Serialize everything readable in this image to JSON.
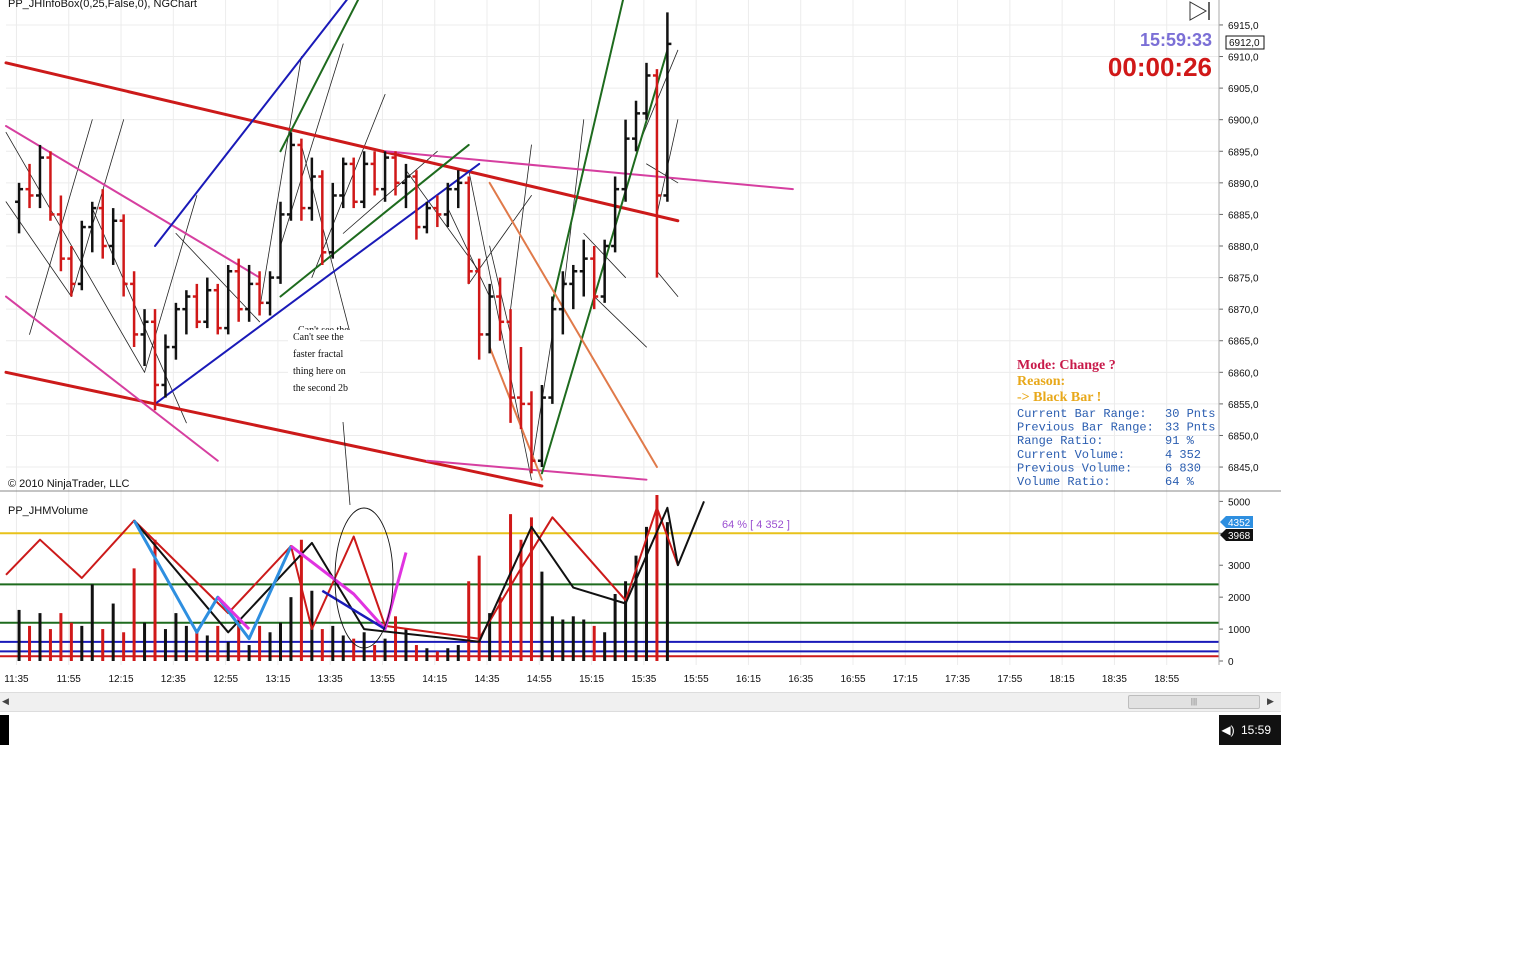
{
  "window": {
    "title": "PP_JHInfoBox(0,25,False,0), NGChart",
    "copyright": "© 2010 NinjaTrader, LLC",
    "volume_panel_title": "PP_JHMVolume"
  },
  "clock": {
    "time": "15:59:33",
    "countdown": "00:00:26"
  },
  "price_marker": "6912,0",
  "volume_markers": {
    "current": "4352",
    "threshold": "3968"
  },
  "volume_annotation": "64 % [ 4 352 ]",
  "note_text": [
    "Can't see the",
    "faster fractal",
    "thing here on",
    "the second 2b"
  ],
  "note_overlap_text": "Can't see the",
  "info_box": {
    "mode": "Mode: Change ?",
    "reason_label": "Reason:",
    "reason_value": "->  Black Bar !",
    "rows": [
      {
        "label": "Current Bar Range:",
        "value": "30 Pnts"
      },
      {
        "label": "Previous Bar Range:",
        "value": "33 Pnts"
      },
      {
        "label": "Range Ratio:",
        "value": "91 %"
      },
      {
        "label": "Current Volume:",
        "value": "4 352"
      },
      {
        "label": "Previous Volume:",
        "value": "6 830"
      },
      {
        "label": "Volume Ratio:",
        "value": "64 %"
      }
    ]
  },
  "taskbar_time": "15:59",
  "colors": {
    "bull": "#111111",
    "bear": "#d01818",
    "trend_red": "#cc1a1a",
    "pink": "#d63fa0",
    "blue": "#1a1ab8",
    "green": "#1e6b1e",
    "orange": "#e07a4a",
    "light_blue": "#2e8fe0",
    "magenta": "#e033e0",
    "yellow": "#e8c21a"
  },
  "chart_data": [
    {
      "type": "ohlc",
      "y_ticks": [
        "6915,0",
        "6910,0",
        "6905,0",
        "6900,0",
        "6895,0",
        "6890,0",
        "6885,0",
        "6880,0",
        "6875,0",
        "6870,0",
        "6865,0",
        "6860,0",
        "6855,0",
        "6850,0",
        "6845,0"
      ],
      "ylim": [
        6842,
        6918
      ],
      "time_range": [
        "11:31",
        "19:15"
      ],
      "bars": [
        {
          "t": "11:36",
          "o": 6887,
          "h": 6890,
          "l": 6882,
          "c": 6889
        },
        {
          "t": "11:40",
          "o": 6889,
          "h": 6893,
          "l": 6886,
          "c": 6888
        },
        {
          "t": "11:44",
          "o": 6888,
          "h": 6896,
          "l": 6886,
          "c": 6894
        },
        {
          "t": "11:48",
          "o": 6894,
          "h": 6895,
          "l": 6884,
          "c": 6885
        },
        {
          "t": "11:52",
          "o": 6885,
          "h": 6888,
          "l": 6876,
          "c": 6878
        },
        {
          "t": "11:56",
          "o": 6878,
          "h": 6880,
          "l": 6872,
          "c": 6874
        },
        {
          "t": "12:00",
          "o": 6874,
          "h": 6884,
          "l": 6873,
          "c": 6883
        },
        {
          "t": "12:04",
          "o": 6883,
          "h": 6887,
          "l": 6879,
          "c": 6886
        },
        {
          "t": "12:08",
          "o": 6886,
          "h": 6889,
          "l": 6878,
          "c": 6880
        },
        {
          "t": "12:12",
          "o": 6880,
          "h": 6886,
          "l": 6877,
          "c": 6884
        },
        {
          "t": "12:16",
          "o": 6884,
          "h": 6885,
          "l": 6872,
          "c": 6874
        },
        {
          "t": "12:20",
          "o": 6874,
          "h": 6876,
          "l": 6864,
          "c": 6866
        },
        {
          "t": "12:24",
          "o": 6866,
          "h": 6870,
          "l": 6861,
          "c": 6868
        },
        {
          "t": "12:28",
          "o": 6868,
          "h": 6870,
          "l": 6854,
          "c": 6858
        },
        {
          "t": "12:32",
          "o": 6858,
          "h": 6866,
          "l": 6856,
          "c": 6864
        },
        {
          "t": "12:36",
          "o": 6864,
          "h": 6871,
          "l": 6862,
          "c": 6870
        },
        {
          "t": "12:40",
          "o": 6870,
          "h": 6873,
          "l": 6866,
          "c": 6872
        },
        {
          "t": "12:44",
          "o": 6872,
          "h": 6874,
          "l": 6867,
          "c": 6868
        },
        {
          "t": "12:48",
          "o": 6868,
          "h": 6875,
          "l": 6867,
          "c": 6873
        },
        {
          "t": "12:52",
          "o": 6873,
          "h": 6874,
          "l": 6866,
          "c": 6867
        },
        {
          "t": "12:56",
          "o": 6867,
          "h": 6877,
          "l": 6866,
          "c": 6876
        },
        {
          "t": "13:00",
          "o": 6876,
          "h": 6878,
          "l": 6868,
          "c": 6870
        },
        {
          "t": "13:04",
          "o": 6870,
          "h": 6877,
          "l": 6868,
          "c": 6874
        },
        {
          "t": "13:08",
          "o": 6874,
          "h": 6876,
          "l": 6869,
          "c": 6871
        },
        {
          "t": "13:12",
          "o": 6871,
          "h": 6876,
          "l": 6869,
          "c": 6875
        },
        {
          "t": "13:16",
          "o": 6875,
          "h": 6887,
          "l": 6874,
          "c": 6885
        },
        {
          "t": "13:20",
          "o": 6885,
          "h": 6898,
          "l": 6884,
          "c": 6896
        },
        {
          "t": "13:24",
          "o": 6896,
          "h": 6897,
          "l": 6884,
          "c": 6886
        },
        {
          "t": "13:28",
          "o": 6886,
          "h": 6894,
          "l": 6884,
          "c": 6891
        },
        {
          "t": "13:32",
          "o": 6891,
          "h": 6892,
          "l": 6877,
          "c": 6879
        },
        {
          "t": "13:36",
          "o": 6879,
          "h": 6890,
          "l": 6878,
          "c": 6888
        },
        {
          "t": "13:40",
          "o": 6888,
          "h": 6894,
          "l": 6886,
          "c": 6893
        },
        {
          "t": "13:44",
          "o": 6893,
          "h": 6894,
          "l": 6886,
          "c": 6887
        },
        {
          "t": "13:48",
          "o": 6887,
          "h": 6895,
          "l": 6886,
          "c": 6893
        },
        {
          "t": "13:52",
          "o": 6893,
          "h": 6895,
          "l": 6888,
          "c": 6889
        },
        {
          "t": "13:56",
          "o": 6889,
          "h": 6895,
          "l": 6887,
          "c": 6894
        },
        {
          "t": "14:00",
          "o": 6894,
          "h": 6895,
          "l": 6888,
          "c": 6890
        },
        {
          "t": "14:04",
          "o": 6890,
          "h": 6893,
          "l": 6886,
          "c": 6891
        },
        {
          "t": "14:08",
          "o": 6891,
          "h": 6892,
          "l": 6881,
          "c": 6883
        },
        {
          "t": "14:12",
          "o": 6883,
          "h": 6887,
          "l": 6882,
          "c": 6886
        },
        {
          "t": "14:16",
          "o": 6886,
          "h": 6888,
          "l": 6883,
          "c": 6885
        },
        {
          "t": "14:20",
          "o": 6885,
          "h": 6890,
          "l": 6883,
          "c": 6889
        },
        {
          "t": "14:24",
          "o": 6889,
          "h": 6892,
          "l": 6886,
          "c": 6890
        },
        {
          "t": "14:28",
          "o": 6890,
          "h": 6891,
          "l": 6874,
          "c": 6876
        },
        {
          "t": "14:32",
          "o": 6876,
          "h": 6878,
          "l": 6862,
          "c": 6866
        },
        {
          "t": "14:36",
          "o": 6866,
          "h": 6874,
          "l": 6863,
          "c": 6872
        },
        {
          "t": "14:40",
          "o": 6872,
          "h": 6875,
          "l": 6865,
          "c": 6868
        },
        {
          "t": "14:44",
          "o": 6868,
          "h": 6870,
          "l": 6852,
          "c": 6856
        },
        {
          "t": "14:48",
          "o": 6856,
          "h": 6864,
          "l": 6851,
          "c": 6855
        },
        {
          "t": "14:52",
          "o": 6855,
          "h": 6857,
          "l": 6844,
          "c": 6846
        },
        {
          "t": "14:56",
          "o": 6846,
          "h": 6858,
          "l": 6845,
          "c": 6856
        },
        {
          "t": "15:00",
          "o": 6856,
          "h": 6872,
          "l": 6855,
          "c": 6870
        },
        {
          "t": "15:04",
          "o": 6870,
          "h": 6876,
          "l": 6866,
          "c": 6874
        },
        {
          "t": "15:08",
          "o": 6874,
          "h": 6877,
          "l": 6870,
          "c": 6876
        },
        {
          "t": "15:12",
          "o": 6876,
          "h": 6881,
          "l": 6872,
          "c": 6878
        },
        {
          "t": "15:16",
          "o": 6878,
          "h": 6880,
          "l": 6870,
          "c": 6872
        },
        {
          "t": "15:20",
          "o": 6872,
          "h": 6881,
          "l": 6871,
          "c": 6880
        },
        {
          "t": "15:24",
          "o": 6880,
          "h": 6891,
          "l": 6879,
          "c": 6889
        },
        {
          "t": "15:28",
          "o": 6889,
          "h": 6900,
          "l": 6887,
          "c": 6897
        },
        {
          "t": "15:32",
          "o": 6897,
          "h": 6903,
          "l": 6895,
          "c": 6901
        },
        {
          "t": "15:36",
          "o": 6901,
          "h": 6909,
          "l": 6900,
          "c": 6907
        },
        {
          "t": "15:40",
          "o": 6907,
          "h": 6908,
          "l": 6875,
          "c": 6888
        },
        {
          "t": "15:44",
          "o": 6888,
          "h": 6917,
          "l": 6887,
          "c": 6912
        }
      ]
    },
    {
      "type": "bar",
      "title": "PP_JHMVolume",
      "y_ticks": [
        "5000",
        "4000",
        "3000",
        "2000",
        "1000",
        "0"
      ],
      "ylim": [
        0,
        5200
      ],
      "x_ticks": [
        "11:35",
        "11:55",
        "12:15",
        "12:35",
        "12:55",
        "13:15",
        "13:35",
        "13:55",
        "14:15",
        "14:35",
        "14:55",
        "15:15",
        "15:35",
        "15:55",
        "16:15",
        "16:35",
        "16:55",
        "17:15",
        "17:35",
        "17:55",
        "18:15",
        "18:35",
        "18:55"
      ],
      "volumes": [
        1600,
        1100,
        1500,
        1000,
        1500,
        1200,
        1100,
        2400,
        1000,
        1800,
        900,
        2900,
        1200,
        3800,
        1000,
        1500,
        1100,
        1000,
        800,
        1100,
        600,
        1300,
        500,
        1100,
        900,
        1200,
        2000,
        3800,
        2200,
        1000,
        1100,
        800,
        700,
        900,
        500,
        700,
        1400,
        1000,
        500,
        400,
        300,
        400,
        500,
        2500,
        3300,
        1500,
        2000,
        4600,
        3800,
        4500,
        2800,
        1400,
        1300,
        1400,
        1300,
        1100,
        900,
        2100,
        2500,
        3300,
        4200,
        5200,
        4352
      ],
      "hlines": [
        {
          "y": 4000,
          "color": "yellow"
        },
        {
          "y": 2400,
          "color": "green"
        },
        {
          "y": 1200,
          "color": "green"
        },
        {
          "y": 600,
          "color": "blue"
        },
        {
          "y": 300,
          "color": "blue"
        },
        {
          "y": 150,
          "color": "trend_red"
        }
      ]
    }
  ]
}
